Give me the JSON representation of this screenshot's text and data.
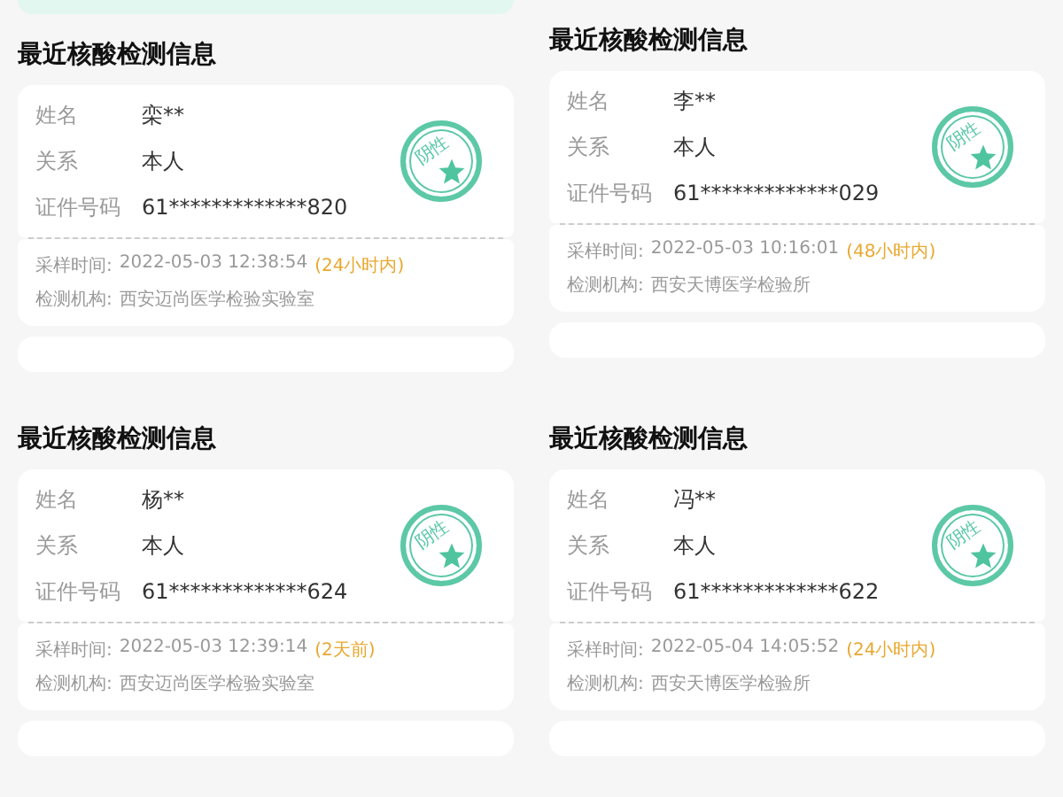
{
  "panels": [
    {
      "top_banner": true,
      "title": "最近核酸检测信息",
      "fields": [
        {
          "label": "姓名",
          "value": "栾**"
        },
        {
          "label": "关系",
          "value": "本人"
        },
        {
          "label": "证件号码",
          "value": "61*************820"
        }
      ],
      "stamp": "阴性",
      "sample_label": "采样时间:",
      "sample_time": "2022-05-03 12:38:54",
      "time_note": "(24小时内)",
      "agency_label": "检测机构:",
      "agency": "西安迈尚医学检验实验室"
    },
    {
      "top_banner": false,
      "title": "最近核酸检测信息",
      "fields": [
        {
          "label": "姓名",
          "value": "李**"
        },
        {
          "label": "关系",
          "value": "本人"
        },
        {
          "label": "证件号码",
          "value": "61*************029"
        }
      ],
      "stamp": "阴性",
      "sample_label": "采样时间:",
      "sample_time": "2022-05-03 10:16:01",
      "time_note": "(48小时内)",
      "agency_label": "检测机构:",
      "agency": "西安天博医学检验所"
    },
    {
      "top_banner": false,
      "title": "最近核酸检测信息",
      "fields": [
        {
          "label": "姓名",
          "value": "杨**"
        },
        {
          "label": "关系",
          "value": "本人"
        },
        {
          "label": "证件号码",
          "value": "61*************624"
        }
      ],
      "stamp": "阴性",
      "sample_label": "采样时间:",
      "sample_time": "2022-05-03 12:39:14",
      "time_note": "(2天前)",
      "agency_label": "检测机构:",
      "agency": "西安迈尚医学检验实验室"
    },
    {
      "top_banner": false,
      "title": "最近核酸检测信息",
      "fields": [
        {
          "label": "姓名",
          "value": "冯**"
        },
        {
          "label": "关系",
          "value": "本人"
        },
        {
          "label": "证件号码",
          "value": "61*************622"
        }
      ],
      "stamp": "阴性",
      "sample_label": "采样时间:",
      "sample_time": "2022-05-04 14:05:52",
      "time_note": "(24小时内)",
      "agency_label": "检测机构:",
      "agency": "西安天博医学检验所"
    }
  ]
}
